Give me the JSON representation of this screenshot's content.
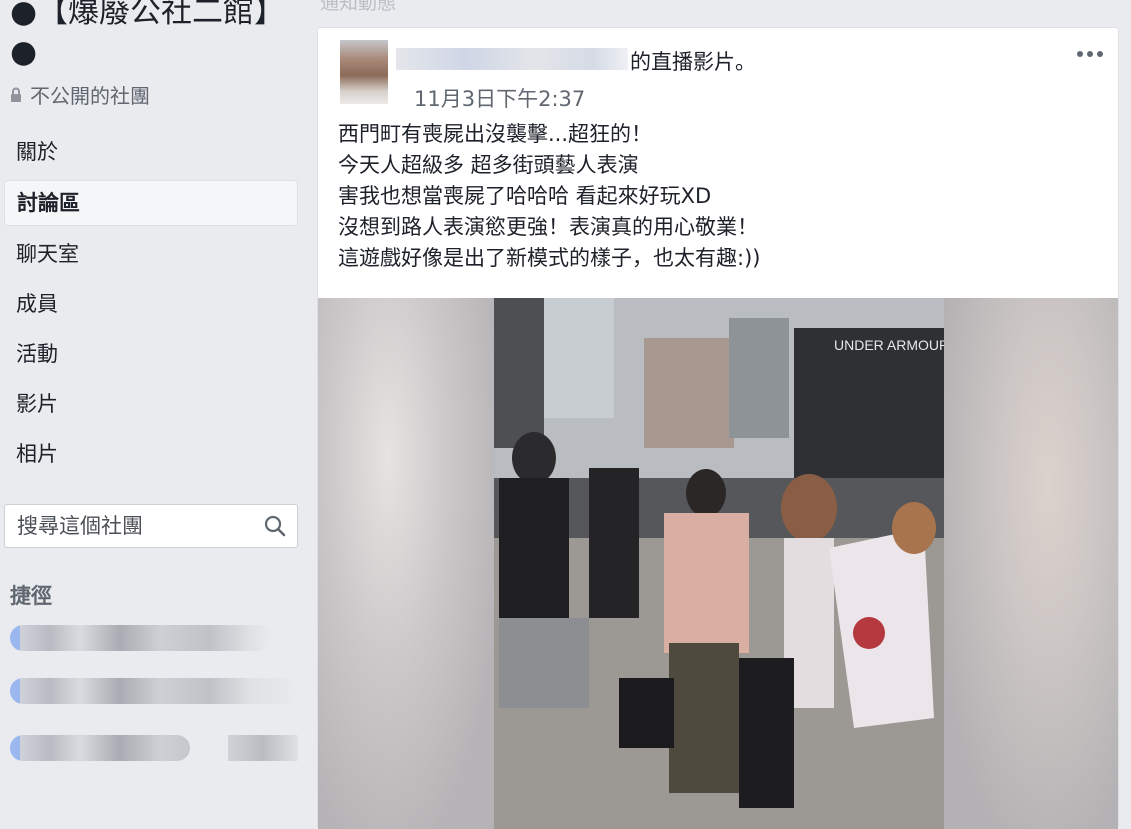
{
  "group": {
    "title": "●【爆廢公社二館】●",
    "privacy": "不公開的社團"
  },
  "nav": {
    "items": [
      {
        "label": "關於"
      },
      {
        "label": "討論區"
      },
      {
        "label": "聊天室"
      },
      {
        "label": "成員"
      },
      {
        "label": "活動"
      },
      {
        "label": "影片"
      },
      {
        "label": "相片"
      }
    ],
    "active_index": 1
  },
  "search": {
    "placeholder": "搜尋這個社團"
  },
  "shortcuts": {
    "title": "捷徑"
  },
  "feed": {
    "top_stub": "通知動態"
  },
  "post": {
    "live_suffix": "的直播影片。",
    "timestamp": "11月3日下午2:37",
    "body": "西門町有喪屍出沒襲擊...超狂的！\n今天人超級多 超多街頭藝人表演\n害我也想當喪屍了哈哈哈 看起來好玩XD\n沒想到路人表演慾更強！表演真的用心敬業！\n這遊戲好像是出了新模式的樣子，也太有趣:))",
    "video": {
      "store_sign": "UNDER ARMOUR"
    }
  },
  "colors": {
    "background": "#e9ebee",
    "card": "#ffffff",
    "text": "#1d2129",
    "secondary_text": "#606770"
  }
}
